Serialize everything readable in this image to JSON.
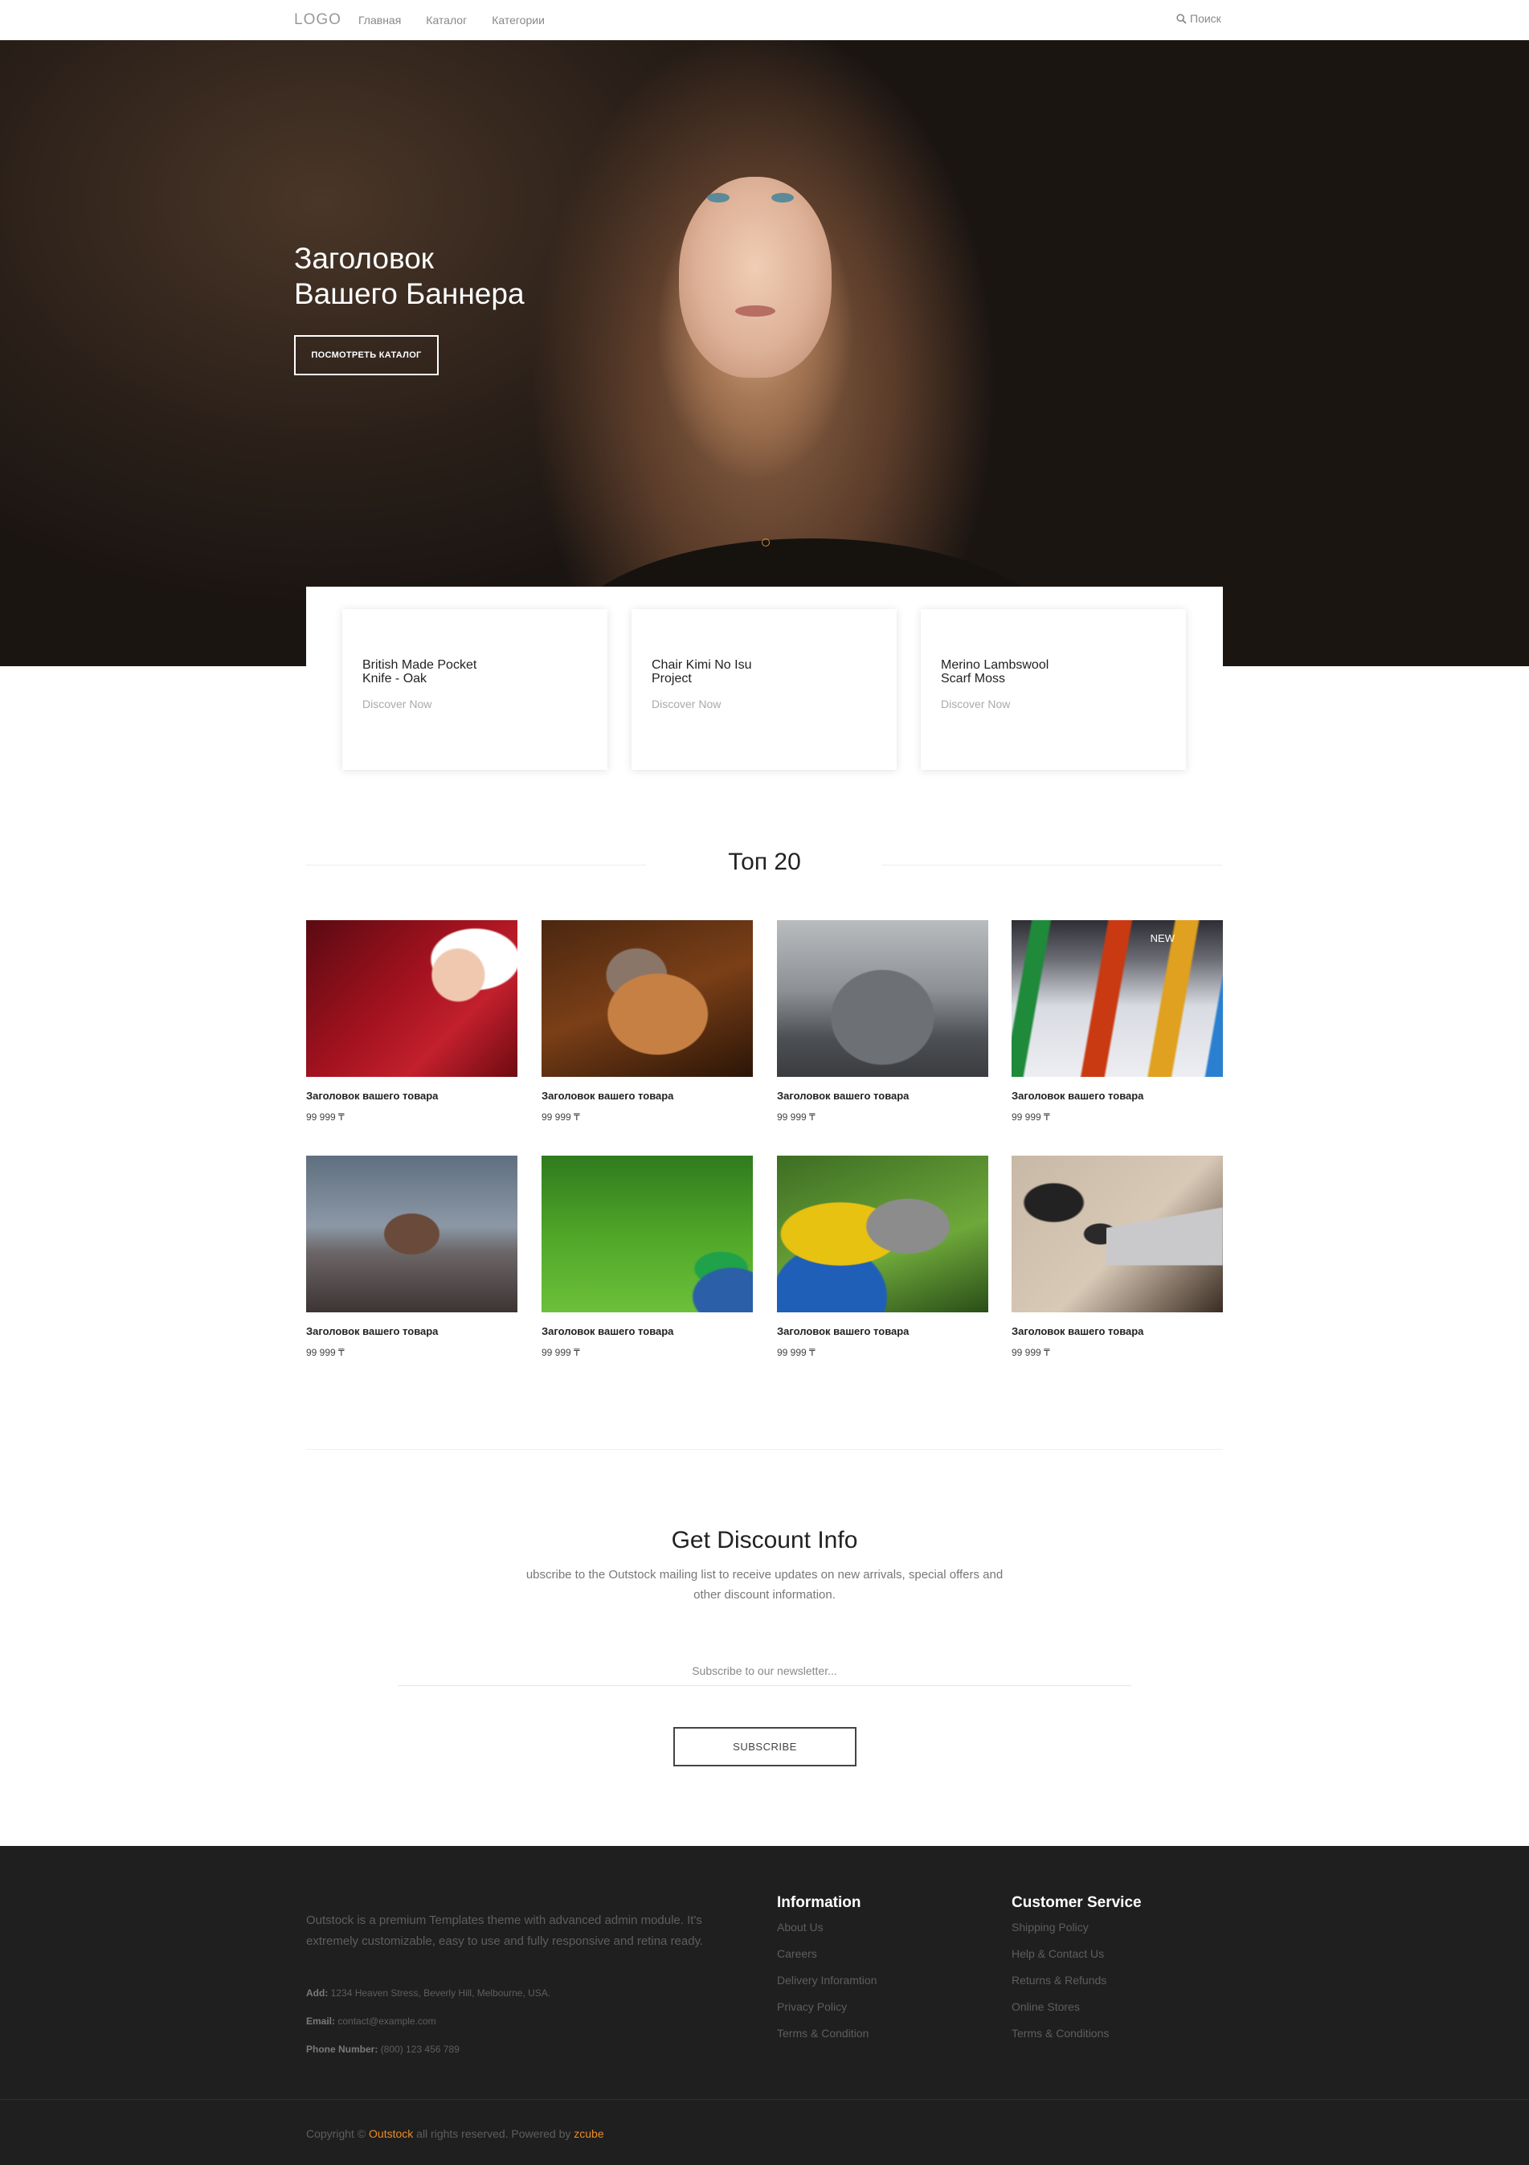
{
  "nav": {
    "logo": "LOGO",
    "menu": [
      "Главная",
      "Каталог",
      "Категории"
    ],
    "search_label": "Поиск"
  },
  "hero": {
    "title_line1": "Заголовок",
    "title_line2": "Вашего Баннера",
    "button_label": "ПОСМОТРЕТЬ КАТАЛОГ"
  },
  "features": [
    {
      "title_line1": "British Made Pocket",
      "title_line2": "Knife - Oak",
      "link": "Discover Now"
    },
    {
      "title_line1": "Chair Kimi No Isu",
      "title_line2": "Project",
      "link": "Discover Now"
    },
    {
      "title_line1": "Merino Lambswool",
      "title_line2": "Scarf Moss",
      "link": "Discover Now"
    }
  ],
  "top": {
    "title": "Топ 20",
    "products": [
      {
        "name": "Заголовок вашего товара",
        "price": "99 999 ₸",
        "badge": ""
      },
      {
        "name": "Заголовок вашего товара",
        "price": "99 999 ₸",
        "badge": ""
      },
      {
        "name": "Заголовок вашего товара",
        "price": "99 999 ₸",
        "badge": ""
      },
      {
        "name": "Заголовок вашего товара",
        "price": "99 999 ₸",
        "badge": "NEW"
      },
      {
        "name": "Заголовок вашего товара",
        "price": "99 999 ₸",
        "badge": ""
      },
      {
        "name": "Заголовок вашего товара",
        "price": "99 999 ₸",
        "badge": ""
      },
      {
        "name": "Заголовок вашего товара",
        "price": "99 999 ₸",
        "badge": ""
      },
      {
        "name": "Заголовок вашего товара",
        "price": "99 999 ₸",
        "badge": ""
      }
    ]
  },
  "newsletter": {
    "title": "Get Discount Info",
    "desc_line1": "ubscribe to the Outstock mailing list to receive updates on new arrivals, special offers and",
    "desc_line2": "other discount information.",
    "placeholder": "Subscribe to our newsletter...",
    "button_label": "SUBSCRIBE"
  },
  "footer": {
    "about": "Outstock is a premium Templates theme with advanced admin module. It's extremely customizable, easy to use and fully responsive and retina ready.",
    "address_label": "Add:",
    "address": "1234 Heaven Stress, Beverly Hill, Melbourne, USA.",
    "email_label": "Email:",
    "email": "contact@example.com",
    "phone_label": "Phone Number:",
    "phone": "(800) 123 456 789",
    "information": {
      "title": "Information",
      "links": [
        "About Us",
        "Careers",
        "Delivery Inforamtion",
        "Privacy Policy",
        "Terms & Condition"
      ]
    },
    "customer_service": {
      "title": "Customer Service",
      "links": [
        "Shipping Policy",
        "Help & Contact Us",
        "Returns & Refunds",
        "Online Stores",
        "Terms & Conditions"
      ]
    },
    "copyright_prefix": "Copyright ©",
    "brand": "Outstock",
    "copyright_middle": "all rights reserved. Powered by",
    "powered_by": "zcube"
  },
  "colors": {
    "accent": "#e88c25",
    "footer_bg": "#1f1f1f"
  }
}
